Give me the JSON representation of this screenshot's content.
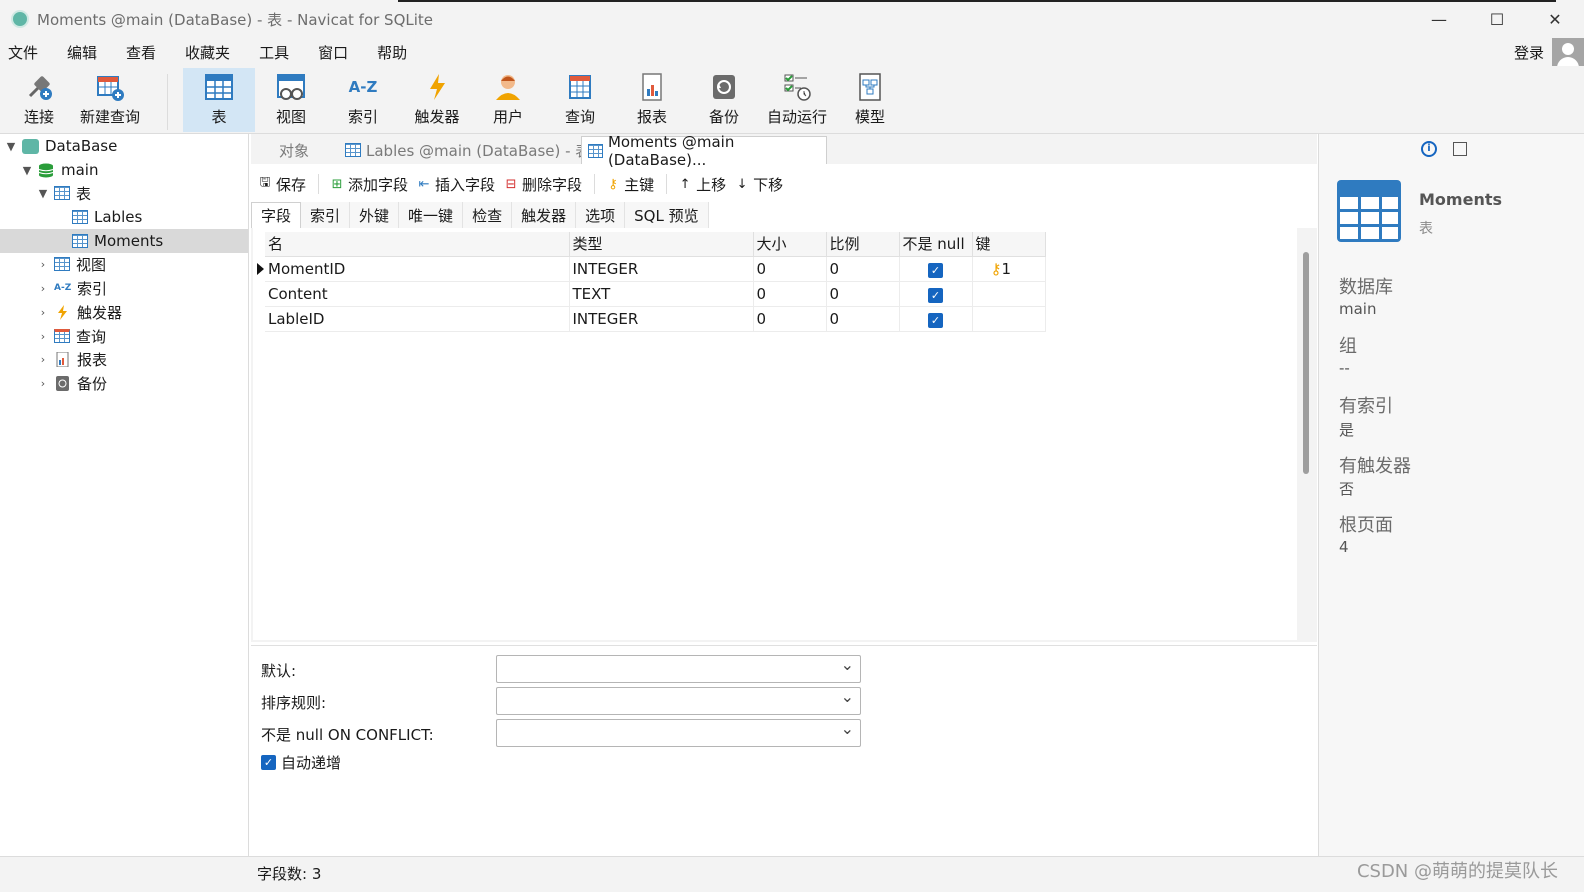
{
  "window": {
    "title": "Moments @main (DataBase) - 表 - Navicat for SQLite",
    "minimize": "—",
    "maximize": "☐",
    "close": "✕"
  },
  "menu": [
    "文件",
    "编辑",
    "查看",
    "收藏夹",
    "工具",
    "窗口",
    "帮助"
  ],
  "login": "登录",
  "toolbar": {
    "connect": "连接",
    "new_query": "新建查询",
    "table": "表",
    "view": "视图",
    "index": "索引",
    "index_icon_text": "A-Z",
    "trigger": "触发器",
    "user": "用户",
    "query": "查询",
    "report": "报表",
    "backup": "备份",
    "automation": "自动运行",
    "model": "模型"
  },
  "tree": {
    "database": "DataBase",
    "schema": "main",
    "tables_group": "表",
    "tables": [
      "Lables",
      "Moments"
    ],
    "views": "视图",
    "indexes": "索引",
    "triggers": "触发器",
    "queries": "查询",
    "reports": "报表",
    "backups": "备份"
  },
  "tabs": {
    "objects": "对象",
    "tab1": "Lables @main (DataBase) - 表",
    "tab2": "Moments @main (DataBase)..."
  },
  "editor_toolbar": {
    "save": "保存",
    "add_field": "添加字段",
    "insert_field": "插入字段",
    "delete_field": "删除字段",
    "primary_key": "主键",
    "move_up": "上移",
    "move_down": "下移"
  },
  "subtabs": [
    "字段",
    "索引",
    "外键",
    "唯一键",
    "检查",
    "触发器",
    "选项",
    "SQL 预览"
  ],
  "fields_table": {
    "columns": [
      "名",
      "类型",
      "大小",
      "比例",
      "不是 null",
      "键"
    ],
    "rows": [
      {
        "name": "MomentID",
        "type": "INTEGER",
        "size": "0",
        "scale": "0",
        "not_null": true,
        "key": "1"
      },
      {
        "name": "Content",
        "type": "TEXT",
        "size": "0",
        "scale": "0",
        "not_null": true,
        "key": ""
      },
      {
        "name": "LableID",
        "type": "INTEGER",
        "size": "0",
        "scale": "0",
        "not_null": true,
        "key": ""
      }
    ]
  },
  "props": {
    "default_label": "默认:",
    "collation_label": "排序规则:",
    "conflict_label": "不是 null ON CONFLICT:",
    "autoinc_label": "自动递增",
    "autoinc_checked": true
  },
  "info": {
    "name": "Moments",
    "kind": "表",
    "database_label": "数据库",
    "database_value": "main",
    "group_label": "组",
    "group_value": "--",
    "has_index_label": "有索引",
    "has_index_value": "是",
    "has_trigger_label": "有触发器",
    "has_trigger_value": "否",
    "root_page_label": "根页面",
    "root_page_value": "4"
  },
  "status": {
    "field_count": "字段数: 3",
    "watermark": "CSDN @萌萌的提莫队长"
  },
  "colors": {
    "accent": "#2f7bc0",
    "checkbox": "#1565c0",
    "active_tool": "#d3e6f5",
    "selected_tree": "#d9d9d9"
  }
}
